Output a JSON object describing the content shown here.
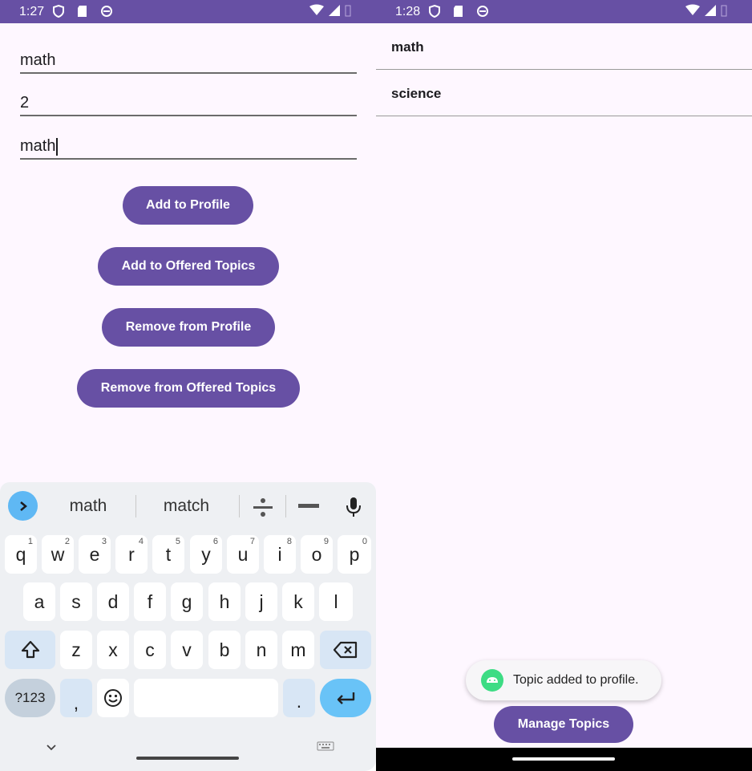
{
  "left": {
    "status": {
      "time": "1:27"
    },
    "fields": [
      {
        "value": "math"
      },
      {
        "value": "2"
      },
      {
        "value": "math"
      }
    ],
    "buttons": {
      "add_profile": "Add to Profile",
      "add_offered": "Add to Offered Topics",
      "remove_profile": "Remove from Profile",
      "remove_offered": "Remove from Offered Topics"
    },
    "keyboard": {
      "suggestions": [
        "math",
        "match"
      ],
      "row1": [
        {
          "k": "q",
          "n": "1"
        },
        {
          "k": "w",
          "n": "2"
        },
        {
          "k": "e",
          "n": "3"
        },
        {
          "k": "r",
          "n": "4"
        },
        {
          "k": "t",
          "n": "5"
        },
        {
          "k": "y",
          "n": "6"
        },
        {
          "k": "u",
          "n": "7"
        },
        {
          "k": "i",
          "n": "8"
        },
        {
          "k": "o",
          "n": "9"
        },
        {
          "k": "p",
          "n": "0"
        }
      ],
      "row2": [
        "a",
        "s",
        "d",
        "f",
        "g",
        "h",
        "j",
        "k",
        "l"
      ],
      "row3": [
        "z",
        "x",
        "c",
        "v",
        "b",
        "n",
        "m"
      ],
      "symbols_key": "?123",
      "comma_key": ",",
      "period_key": "."
    }
  },
  "right": {
    "status": {
      "time": "1:28"
    },
    "topics": [
      "math",
      "science"
    ],
    "toast": "Topic added to profile.",
    "manage_button": "Manage Topics"
  },
  "colors": {
    "primary": "#6750a4",
    "background": "#fef7ff",
    "enter_key": "#69c3f7",
    "android_green": "#3ddc84"
  }
}
